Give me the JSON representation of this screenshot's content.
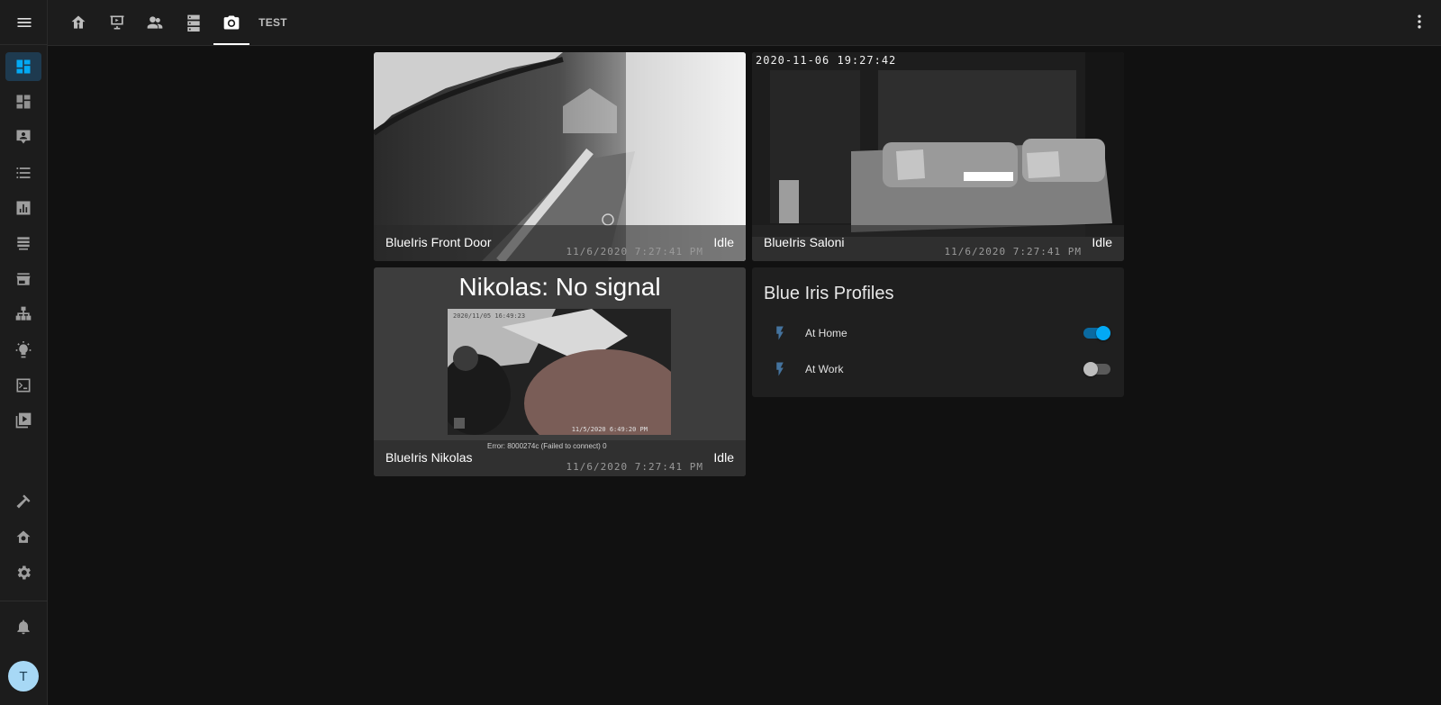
{
  "topbar": {
    "tabs": [
      {
        "icon": "home-icon"
      },
      {
        "icon": "presentation-icon"
      },
      {
        "icon": "people-icon"
      },
      {
        "icon": "server-icon"
      },
      {
        "icon": "camera-icon",
        "active": true
      },
      {
        "label": "TEST"
      }
    ]
  },
  "sidebar": {
    "items": [
      {
        "icon": "dashboard-icon",
        "active": true
      },
      {
        "icon": "dashboard-alt-icon"
      },
      {
        "icon": "account-box-icon"
      },
      {
        "icon": "list-icon"
      },
      {
        "icon": "chart-icon"
      },
      {
        "icon": "database-icon"
      },
      {
        "icon": "store-icon"
      },
      {
        "icon": "sitemap-icon"
      },
      {
        "icon": "lightbulb-icon"
      },
      {
        "icon": "console-icon"
      },
      {
        "icon": "play-box-icon"
      },
      {
        "icon": "hammer-icon"
      },
      {
        "icon": "home-settings-icon"
      },
      {
        "icon": "gear-icon"
      },
      {
        "icon": "bell-icon"
      }
    ],
    "avatar": "T"
  },
  "cameras": [
    {
      "name": "BlueIris Front Door",
      "state": "Idle",
      "timestamp": "11/6/2020 7:27:41 PM"
    },
    {
      "name": "BlueIris Saloni",
      "state": "Idle",
      "timestamp": "11/6/2020 7:27:41 PM",
      "overlay": "2020-11-06 19:27:42"
    },
    {
      "name": "BlueIris Nikolas",
      "state": "Idle",
      "timestamp": "11/6/2020 7:27:41 PM",
      "no_signal": "Nikolas: No signal",
      "error": "Error: 8000274c (Failed to connect) 0",
      "inner_ts_top": "2020/11/05 16:49:23",
      "inner_ts_bottom": "11/5/2020 6:49:20 PM"
    }
  ],
  "profiles": {
    "title": "Blue Iris Profiles",
    "items": [
      {
        "label": "At Home",
        "on": true
      },
      {
        "label": "At Work",
        "on": false
      }
    ]
  },
  "colors": {
    "accent": "#03a9f4",
    "bolt": "#44739e"
  }
}
